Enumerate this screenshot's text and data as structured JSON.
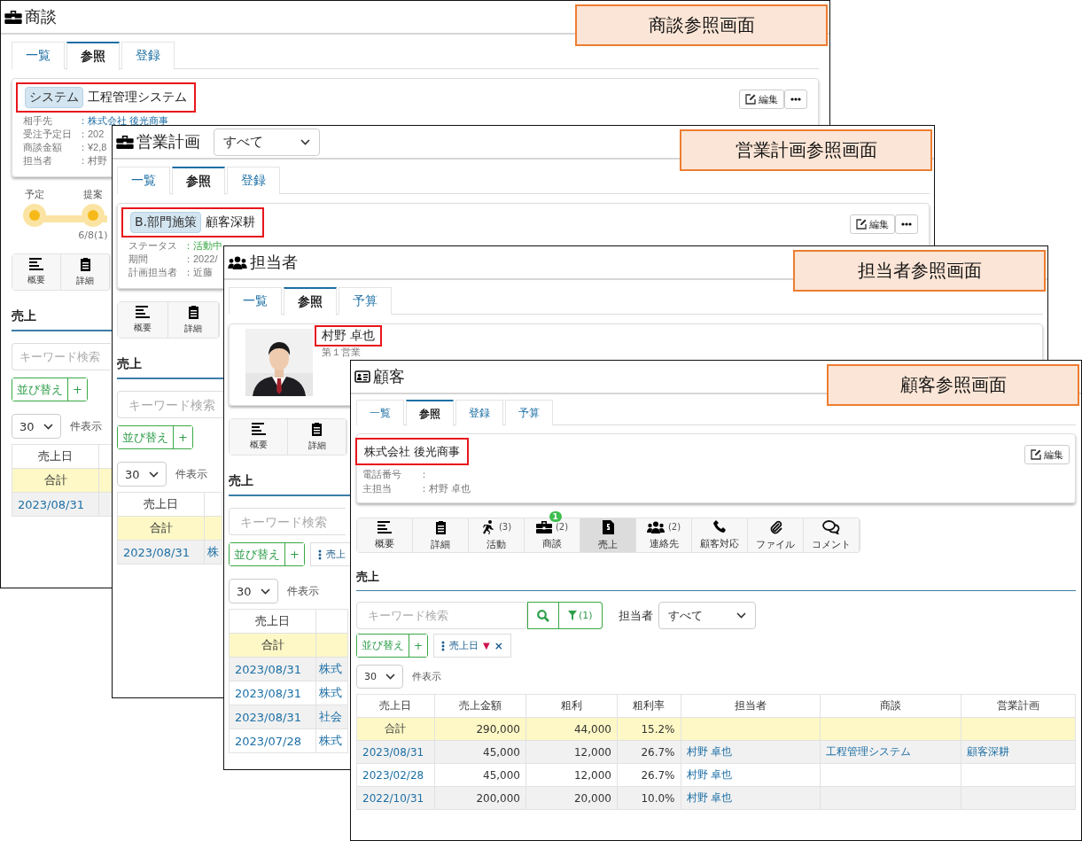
{
  "windows": [
    {
      "kind": "deal",
      "title": "商談",
      "callout": "商談参照画面",
      "tabs": [
        {
          "label": "一覧",
          "selected": false
        },
        {
          "label": "参照",
          "selected": true
        },
        {
          "label": "登録",
          "selected": false
        }
      ],
      "header": {
        "badge": "システム",
        "name": "工程管理システム"
      },
      "edit": "編集",
      "more": true,
      "fields": [
        {
          "label": "相手先",
          "value": "：株式会社 後光商事",
          "kind": "link"
        },
        {
          "label": "受注予定日",
          "value": "：202",
          "kind": "text"
        },
        {
          "label": "商談金額",
          "value": "：¥2,8",
          "kind": "text"
        },
        {
          "label": "担当者",
          "value": "：村野",
          "kind": "text"
        }
      ],
      "steps": [
        {
          "label": "予定"
        },
        {
          "label": "提案",
          "date": "6/8(1)"
        }
      ],
      "nav": [
        {
          "kind": "summary",
          "label": "概要",
          "selected": false
        },
        {
          "kind": "detail",
          "label": "詳細",
          "selected": false
        }
      ],
      "section": "売上",
      "search": {
        "placeholder": "キーワード検索"
      },
      "sort": {
        "label": "並び替え",
        "add": "+"
      },
      "page_size": "30",
      "page_label": "件表示",
      "table": {
        "columns": [
          {
            "label": "売上日",
            "kind": "link"
          },
          {
            "kind": "link"
          }
        ],
        "rows": [
          {
            "kind": "total",
            "cells": [
              "合計"
            ]
          },
          {
            "kind": "data",
            "cells": [
              "2023/08/31"
            ]
          }
        ]
      }
    },
    {
      "kind": "deal",
      "title": "営業計画",
      "title_select": "すべて",
      "callout": "営業計画参照画面",
      "tabs": [
        {
          "label": "一覧",
          "selected": false
        },
        {
          "label": "参照",
          "selected": true
        },
        {
          "label": "登録",
          "selected": false
        }
      ],
      "header": {
        "badge": "B.部門施策",
        "name": "顧客深耕"
      },
      "edit": "編集",
      "more": true,
      "fields": [
        {
          "label": "ステータス",
          "value": "：活動中",
          "kind": "status"
        },
        {
          "label": "期間",
          "value": "：2022/",
          "kind": "text"
        },
        {
          "label": "計画担当者",
          "value": "：近藤",
          "kind": "text"
        }
      ],
      "nav": [
        {
          "kind": "summary",
          "label": "概要",
          "selected": false
        },
        {
          "kind": "detail",
          "label": "詳細",
          "selected": false
        }
      ],
      "section": "売上",
      "search": {
        "placeholder": "キーワード検索"
      },
      "sort": {
        "label": "並び替え",
        "add": "+"
      },
      "page_size": "30",
      "page_label": "件表示",
      "table": {
        "columns": [
          {
            "label": "売上日",
            "kind": "link"
          },
          {
            "kind": "link"
          }
        ],
        "rows": [
          {
            "kind": "total",
            "cells": [
              "合計"
            ]
          },
          {
            "kind": "data",
            "cells": [
              "2023/08/31",
              "株"
            ]
          }
        ]
      }
    },
    {
      "kind": "staff",
      "title": "担当者",
      "callout": "担当者参照画面",
      "tabs": [
        {
          "label": "一覧",
          "selected": false
        },
        {
          "label": "参照",
          "selected": true
        },
        {
          "label": "予算",
          "selected": false
        }
      ],
      "photo": {
        "kind": "picture"
      },
      "header": {
        "name": "村野 卓也",
        "sub": "第１営業"
      },
      "nav": [
        {
          "kind": "summary",
          "label": "概要",
          "selected": false
        },
        {
          "kind": "detail",
          "label": "詳細",
          "selected": false
        }
      ],
      "section": "売上",
      "search": {
        "placeholder": "キーワード検索"
      },
      "sort": {
        "label": "並び替え",
        "add": "+"
      },
      "chip": {
        "label": "売上"
      },
      "page_size": "30",
      "page_label": "件表示",
      "table": {
        "columns": [
          {
            "label": "売上日",
            "kind": "link"
          },
          {
            "kind": "link"
          }
        ],
        "rows": [
          {
            "kind": "total",
            "cells": [
              "合計"
            ]
          },
          {
            "kind": "data",
            "cells": [
              "2023/08/31",
              "株式"
            ]
          },
          {
            "kind": "data",
            "cells": [
              "2023/08/31",
              "株式"
            ]
          },
          {
            "kind": "data",
            "cells": [
              "2023/08/31",
              "社会"
            ]
          },
          {
            "kind": "data",
            "cells": [
              "2023/07/28",
              "株式"
            ]
          }
        ]
      }
    },
    {
      "kind": "customer",
      "title": "顧客",
      "callout": "顧客参照画面",
      "tabs": [
        {
          "label": "一覧",
          "selected": false
        },
        {
          "label": "参照",
          "selected": true
        },
        {
          "label": "登録",
          "selected": false
        },
        {
          "label": "予算",
          "selected": false
        }
      ],
      "header": {
        "name": "株式会社 後光商事"
      },
      "edit": "編集",
      "fields": [
        {
          "label": "電話番号",
          "value": "：",
          "kind": "text"
        },
        {
          "label": "主担当",
          "value": "：村野 卓也",
          "kind": "text"
        }
      ],
      "nav": [
        {
          "kind": "summary",
          "label": "概要",
          "selected": false
        },
        {
          "kind": "detail",
          "label": "詳細",
          "selected": false
        },
        {
          "kind": "activity",
          "label": "活動",
          "count": "(3)",
          "selected": false
        },
        {
          "kind": "deal",
          "label": "商談",
          "count": "(2)",
          "badge": "1",
          "selected": false
        },
        {
          "kind": "sales",
          "label": "売上",
          "selected": true
        },
        {
          "kind": "contacts",
          "label": "連絡先",
          "count": "(2)",
          "selected": false
        },
        {
          "kind": "phone",
          "label": "顧客対応",
          "selected": false
        },
        {
          "kind": "file",
          "label": "ファイル",
          "selected": false
        },
        {
          "kind": "comment",
          "label": "コメント",
          "selected": false
        }
      ],
      "section": "売上",
      "search": {
        "placeholder": "キーワード検索",
        "filter_count": "(1)"
      },
      "owner_filter": {
        "label": "担当者",
        "value": "すべて"
      },
      "sort": {
        "label": "並び替え",
        "add": "+"
      },
      "chip": {
        "label": "売上日",
        "direction": "▼",
        "remove": "×"
      },
      "page_size": "30",
      "page_label": "件表示",
      "table": {
        "columns": [
          {
            "label": "売上日",
            "kind": "link"
          },
          {
            "label": "売上金額",
            "kind": "number"
          },
          {
            "label": "粗利",
            "kind": "number"
          },
          {
            "label": "粗利率",
            "kind": "number"
          },
          {
            "label": "担当者",
            "kind": "link"
          },
          {
            "label": "商談",
            "kind": "link"
          },
          {
            "label": "営業計画",
            "kind": "link"
          }
        ],
        "rows": [
          {
            "kind": "total",
            "cells": [
              "合計",
              "290,000",
              "44,000",
              "15.2%"
            ]
          },
          {
            "kind": "data",
            "cells": [
              "2023/08/31",
              "45,000",
              "12,000",
              "26.7%",
              "村野 卓也",
              "工程管理システム",
              "顧客深耕"
            ]
          },
          {
            "kind": "data",
            "cells": [
              "2023/02/28",
              "45,000",
              "12,000",
              "26.7%",
              "村野 卓也"
            ]
          },
          {
            "kind": "data",
            "cells": [
              "2022/10/31",
              "200,000",
              "20,000",
              "10.0%",
              "村野 卓也"
            ]
          }
        ]
      }
    }
  ]
}
